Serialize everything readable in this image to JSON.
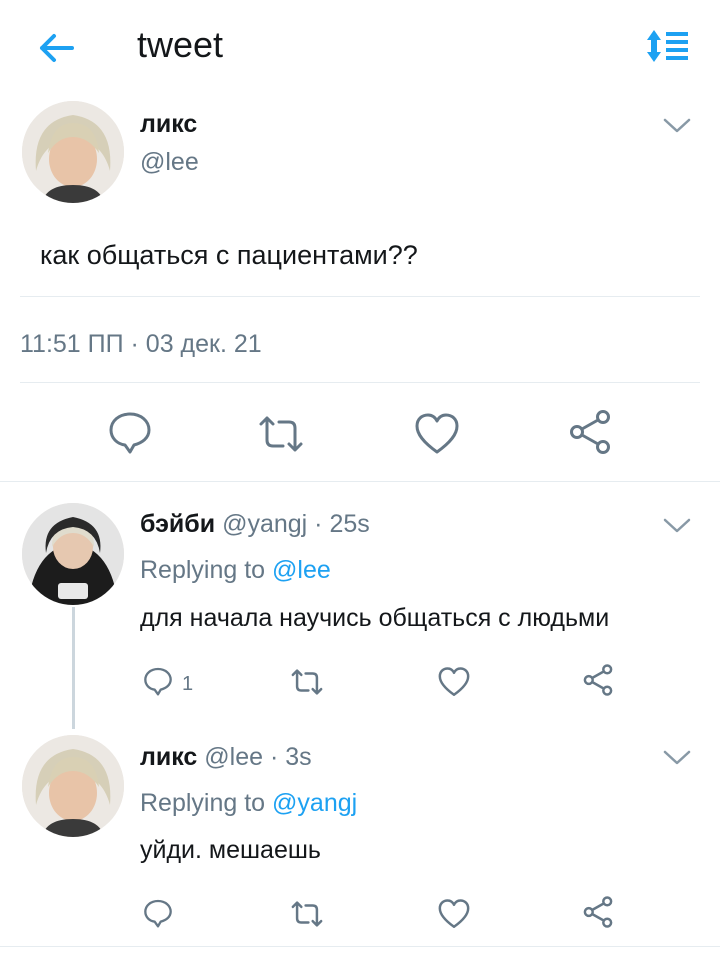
{
  "header": {
    "title": "tweet"
  },
  "tweet": {
    "author_name": "ликс",
    "author_handle": "@lee",
    "text": "как общаться с пациентами??",
    "timestamp": "11:51 ПП · 03 дек. 21"
  },
  "replies": [
    {
      "author_name": "бэйби",
      "author_handle": "@yangj",
      "time": "· 25s",
      "replying_prefix": "Replying to",
      "replying_to": "@lee",
      "text": "для начала научись общаться с людьми",
      "reply_count": "1"
    },
    {
      "author_name": "ликс",
      "author_handle": "@lee",
      "time": "· 3s",
      "replying_prefix": "Replying to",
      "replying_to": "@yangj",
      "text": "уйди. мешаешь",
      "reply_count": ""
    }
  ],
  "icons": {
    "back": "arrow-left-icon",
    "sort": "sort-icon",
    "reply": "speech-bubble-icon",
    "retweet": "retweet-icon",
    "like": "heart-icon",
    "share": "share-icon",
    "more": "chevron-down-icon"
  },
  "colors": {
    "accent": "#1da1f2",
    "muted": "#657786",
    "text": "#14171a",
    "divider": "#e6ecf0"
  }
}
